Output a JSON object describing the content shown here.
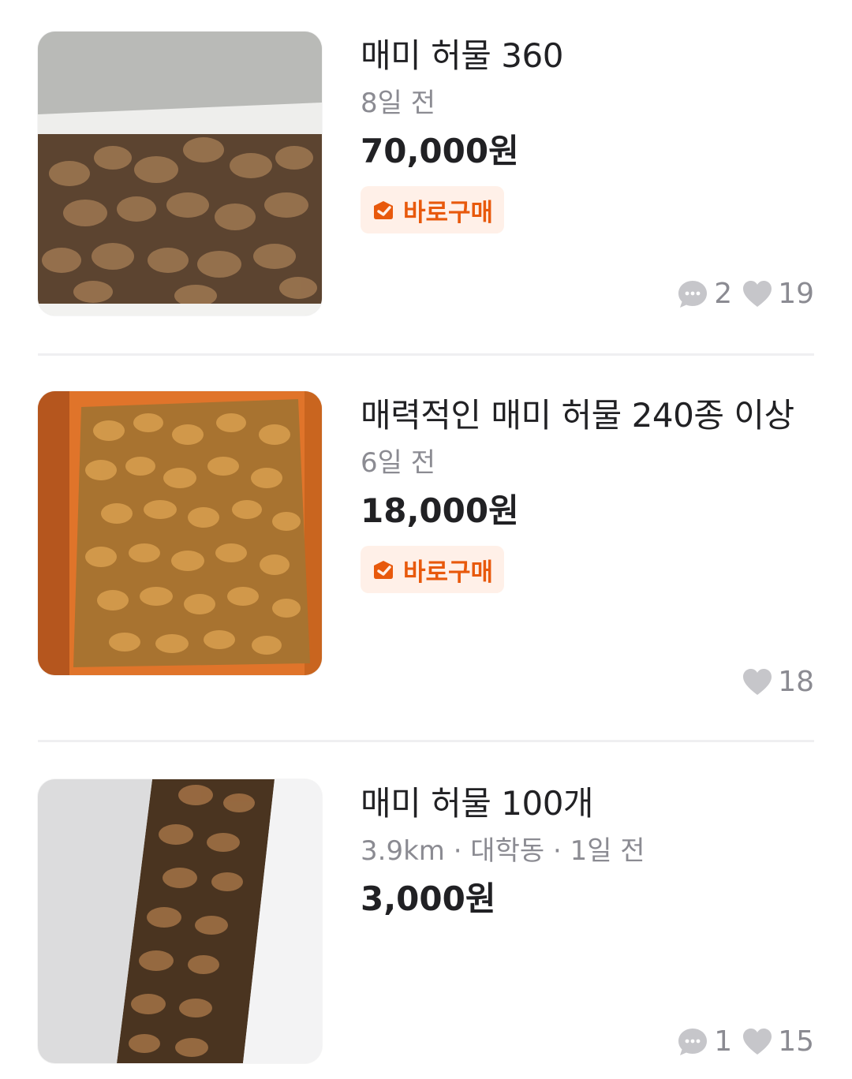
{
  "listings": [
    {
      "title": "매미 허물 360",
      "meta": "8일 전",
      "price": "70,000원",
      "badge": "바로구매",
      "comments": "2",
      "likes": "19",
      "thumb_colors": {
        "bg": "#c9cac7",
        "box": "#6d4f33",
        "accent": "#a07a50"
      }
    },
    {
      "title": "매력적인 매미 허물 240종 이상",
      "meta": "6일 전",
      "price": "18,000원",
      "badge": "바로구매",
      "likes": "18",
      "thumb_colors": {
        "bg": "#e0742a",
        "box": "#b97a2e",
        "accent": "#d89a45"
      }
    },
    {
      "title": "매미 허물 100개",
      "meta": "3.9km · 대학동 · 1일 전",
      "price": "3,000원",
      "comments": "1",
      "likes": "15",
      "thumb_colors": {
        "bg": "#e9e9ea",
        "box": "#5a3f27",
        "accent": "#9a6c42"
      }
    }
  ],
  "icons": {
    "comment": "chat-bubble-icon",
    "like": "heart-icon",
    "badge": "bag-icon"
  },
  "colors": {
    "badge_text": "#e8590c",
    "badge_bg": "#fff0e8",
    "muted": "#8b8b92",
    "icon_gray": "#c6c6ca"
  }
}
